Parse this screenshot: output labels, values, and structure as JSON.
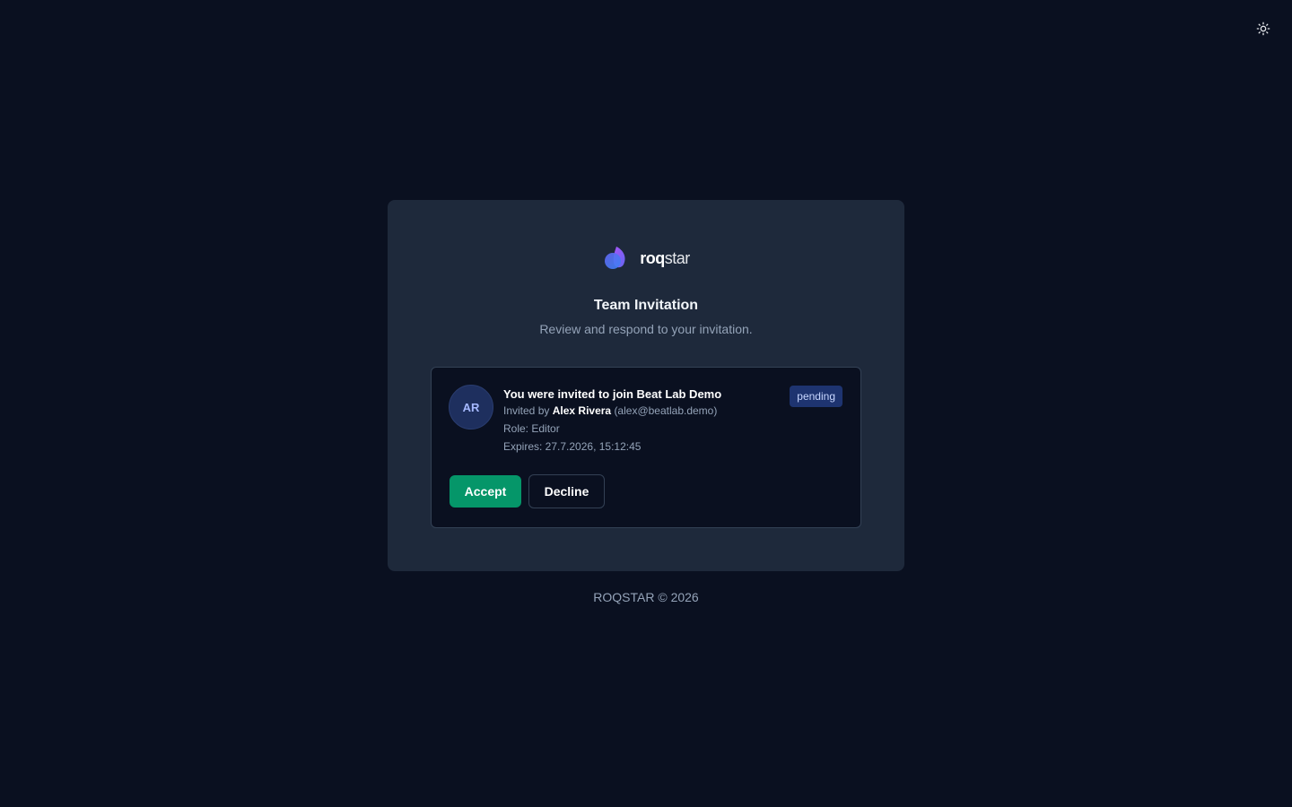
{
  "theme_toggle": {
    "icon": "sun-icon"
  },
  "brand": {
    "name_bold": "roq",
    "name_light": "star",
    "logo_colors": [
      "#8b5cf6",
      "#6366f1",
      "#3b82f6"
    ]
  },
  "header": {
    "title": "Team Invitation",
    "subtitle": "Review and respond to your invitation."
  },
  "invitation": {
    "avatar_initials": "AR",
    "headline": "You were invited to join Beat Lab Demo",
    "invited_by_prefix": "Invited by",
    "inviter_name": "Alex Rivera",
    "inviter_email": "(alex@beatlab.demo)",
    "role": "Role: Editor",
    "expires": "Expires: 27.7.2026, 15:12:45",
    "status": "pending",
    "accept_label": "Accept",
    "decline_label": "Decline"
  },
  "footer": {
    "text": "ROQSTAR © 2026"
  },
  "colors": {
    "background": "#0a1020",
    "card": "#1e293b",
    "accept": "#059669",
    "badge": "#1e3470"
  }
}
